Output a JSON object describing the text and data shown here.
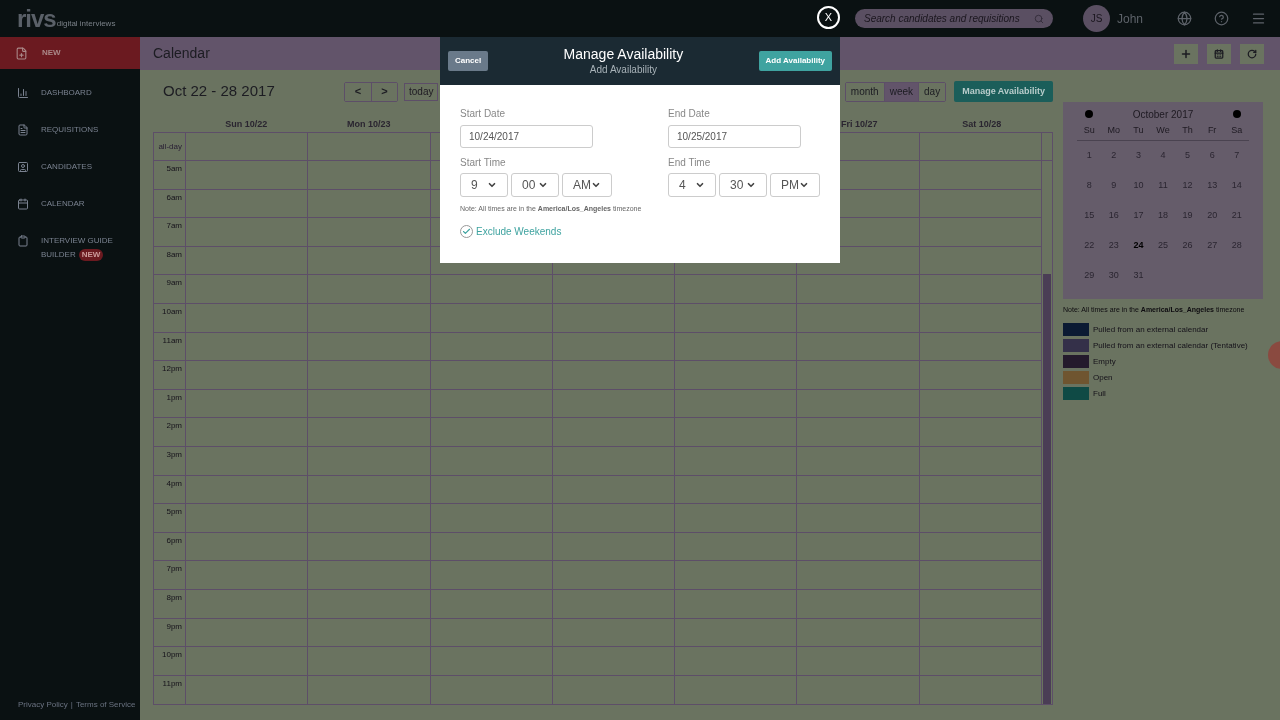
{
  "topbar": {
    "logo": "rivs",
    "logo_tagline": "digital interviews",
    "search_placeholder": "Search candidates and requisitions",
    "user": {
      "initials": "JS",
      "name": "John"
    }
  },
  "sidebar": {
    "new_label": "NEW",
    "items": [
      {
        "kind": "chart",
        "label": "DASHBOARD"
      },
      {
        "kind": "file",
        "label": "REQUISITIONS"
      },
      {
        "kind": "person",
        "label": "CANDIDATES"
      },
      {
        "kind": "calendar",
        "label": "CALENDAR"
      },
      {
        "kind": "clipboard",
        "label": "INTERVIEW GUIDE",
        "label_2": "BUILDER",
        "badge": "NEW"
      }
    ],
    "footer": [
      "Privacy Policy",
      "|",
      "Terms of Service"
    ]
  },
  "header": {
    "title": "Calendar"
  },
  "toolbar": {
    "range": "Oct 22 - 28 2017",
    "prev": "<",
    "next": ">",
    "today": "today",
    "views": [
      {
        "label": "month",
        "selected": false
      },
      {
        "label": "week",
        "selected": true
      },
      {
        "label": "day",
        "selected": false
      }
    ],
    "manage": "Manage Availability"
  },
  "calendar": {
    "columns": [
      {
        "label": "Sun 10/22"
      },
      {
        "label": "Mon 10/23"
      },
      {},
      {},
      {},
      {
        "label": "Fri 10/27"
      },
      {
        "label": "Sat 10/28"
      }
    ],
    "all_day": "all-day",
    "hours": [
      "5am",
      "6am",
      "7am",
      "8am",
      "9am",
      "10am",
      "11am",
      "12pm",
      "1pm",
      "2pm",
      "3pm",
      "4pm",
      "5pm",
      "6pm",
      "7pm",
      "8pm",
      "9pm",
      "10pm",
      "11pm"
    ]
  },
  "mini_calendar": {
    "month": "October 2017",
    "weekdays": [
      "Su",
      "Mo",
      "Tu",
      "We",
      "Th",
      "Fr",
      "Sa"
    ],
    "days": [
      {
        "label": "1",
        "today": false
      },
      {
        "label": "2",
        "today": false
      },
      {
        "label": "3",
        "today": false
      },
      {
        "label": "4",
        "today": false
      },
      {
        "label": "5",
        "today": false
      },
      {
        "label": "6",
        "today": false
      },
      {
        "label": "7",
        "today": false
      },
      {
        "label": "8",
        "today": false
      },
      {
        "label": "9",
        "today": false
      },
      {
        "label": "10",
        "today": false
      },
      {
        "label": "11",
        "today": false
      },
      {
        "label": "12",
        "today": false
      },
      {
        "label": "13",
        "today": false
      },
      {
        "label": "14",
        "today": false
      },
      {
        "label": "15",
        "today": false
      },
      {
        "label": "16",
        "today": false
      },
      {
        "label": "17",
        "today": false
      },
      {
        "label": "18",
        "today": false
      },
      {
        "label": "19",
        "today": false
      },
      {
        "label": "20",
        "today": false
      },
      {
        "label": "21",
        "today": false
      },
      {
        "label": "22",
        "today": false
      },
      {
        "label": "23",
        "today": false
      },
      {
        "label": "24",
        "today": true
      },
      {
        "label": "25",
        "today": false
      },
      {
        "label": "26",
        "today": false
      },
      {
        "label": "27",
        "today": false
      },
      {
        "label": "28",
        "today": false
      },
      {
        "label": "29",
        "today": false
      },
      {
        "label": "30",
        "today": false
      },
      {
        "label": "31",
        "today": false
      }
    ]
  },
  "note": "Note: All times are in the **America/Los_Angeles** timezone",
  "legend": [
    {
      "label": "Pulled from an external calendar",
      "color": "#0b1a33"
    },
    {
      "label": "Pulled from an external calendar (Tentative)",
      "color": "#343049"
    },
    {
      "label": "Empty",
      "color": "#241a2c"
    },
    {
      "label": "Open",
      "color": "#6f5530"
    },
    {
      "label": "Full",
      "color": "#0f4a45"
    }
  ],
  "modal": {
    "close": "X",
    "title": "Manage Availability",
    "subtitle": "Add Availability",
    "cancel": "Cancel",
    "submit": "Add Availability",
    "start_date": {
      "label": "Start Date",
      "value": "10/24/2017"
    },
    "end_date": {
      "label": "End Date",
      "value": "10/25/2017"
    },
    "start_time": {
      "label": "Start Time",
      "parts": [
        "9",
        "00",
        "AM"
      ]
    },
    "end_time": {
      "label": "End Time",
      "parts": [
        "4",
        "30",
        "PM"
      ]
    },
    "note": "Note: All times are in the **America/Los_Angeles** timezone",
    "exclude_weekends": {
      "label": "Exclude Weekends",
      "checked": true
    }
  }
}
